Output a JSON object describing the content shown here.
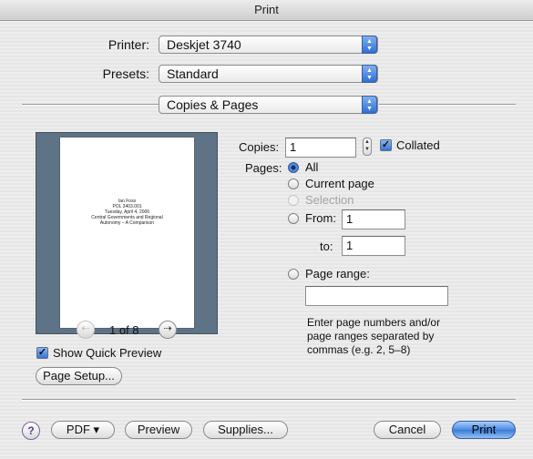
{
  "window": {
    "title": "Print"
  },
  "printer": {
    "label": "Printer:",
    "value": "Deskjet 3740"
  },
  "presets": {
    "label": "Presets:",
    "value": "Standard"
  },
  "panel": {
    "value": "Copies & Pages"
  },
  "preview": {
    "page_text": [
      "Ian Foss",
      "POL 3403.001",
      "Tuesday, April 4, 2006",
      "Central Governments and Regional",
      "Autonomy – A Comparison"
    ],
    "page_indicator": "1 of 8",
    "prev_icon": "left-arrow-icon",
    "next_icon": "right-arrow-icon",
    "show_quick_preview": {
      "label": "Show Quick Preview",
      "checked": true
    }
  },
  "copies": {
    "label": "Copies:",
    "value": "1",
    "collated": {
      "label": "Collated",
      "checked": true
    }
  },
  "pages": {
    "label": "Pages:",
    "all": "All",
    "current_page": "Current page",
    "selection": "Selection",
    "from_label": "From:",
    "from_value": "1",
    "to_label": "to:",
    "to_value": "1",
    "page_range_label": "Page range:",
    "page_range_value": "",
    "hint": "Enter page numbers and/or page ranges separated by commas (e.g. 2, 5–8)"
  },
  "buttons": {
    "page_setup": "Page Setup...",
    "help": "?",
    "pdf": "PDF ▾",
    "preview": "Preview",
    "supplies": "Supplies...",
    "cancel": "Cancel",
    "print": "Print"
  },
  "colors": {
    "accent": "#3c7ad8",
    "preview_bg": "#5f7386"
  }
}
